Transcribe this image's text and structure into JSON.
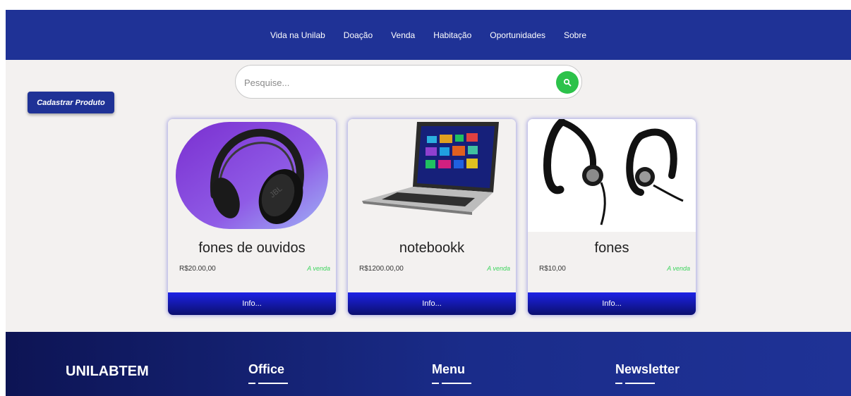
{
  "nav": {
    "items": [
      "Vida na Unilab",
      "Doação",
      "Venda",
      "Habitação",
      "Oportunidades",
      "Sobre"
    ]
  },
  "search": {
    "placeholder": "Pesquise...",
    "value": ""
  },
  "register_button": "Cadastrar Produto",
  "products": [
    {
      "title": "fones de ouvidos",
      "price": "R$20.00,00",
      "status": "A venda",
      "info": "Info..."
    },
    {
      "title": "notebookk",
      "price": "R$1200.00,00",
      "status": "A venda",
      "info": "Info..."
    },
    {
      "title": "fones",
      "price": "R$10,00",
      "status": "A venda",
      "info": "Info..."
    }
  ],
  "footer": {
    "brand": "UNILABTEM",
    "office": "Office",
    "menu": "Menu",
    "newsletter": "Newsletter"
  },
  "colors": {
    "nav": "#1f3296",
    "accent_green": "#2cc24a",
    "info_blue": "#1d22e6"
  }
}
